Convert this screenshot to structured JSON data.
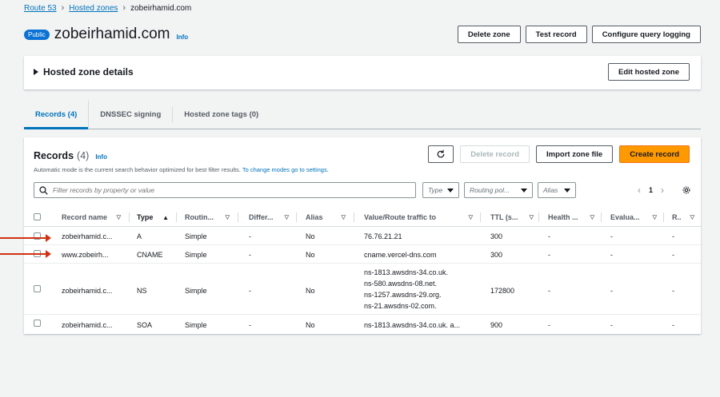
{
  "breadcrumb": {
    "items": [
      "Route 53",
      "Hosted zones"
    ],
    "current": "zobeirhamid.com"
  },
  "header": {
    "badge": "Public",
    "title": "zobeirhamid.com",
    "info": "Info",
    "buttons": {
      "delete_zone": "Delete zone",
      "test_record": "Test record",
      "configure_logging": "Configure query logging"
    }
  },
  "details": {
    "title": "Hosted zone details",
    "edit_button": "Edit hosted zone"
  },
  "tabs": [
    {
      "label": "Records (4)"
    },
    {
      "label": "DNSSEC signing"
    },
    {
      "label": "Hosted zone tags (0)"
    }
  ],
  "records": {
    "title": "Records",
    "count": "(4)",
    "info": "Info",
    "description": "Automatic mode is the current search behavior optimized for best filter results.",
    "description_link": "To change modes go to settings.",
    "buttons": {
      "delete_record": "Delete record",
      "import_zone_file": "Import zone file",
      "create_record": "Create record"
    },
    "search_placeholder": "Filter records by property or value",
    "filters": {
      "type": "Type",
      "routing_policy": "Routing pol...",
      "alias": "Alias"
    },
    "page": "1",
    "columns": {
      "record_name": "Record name",
      "type": "Type",
      "routing": "Routin...",
      "differ": "Differ...",
      "alias": "Alias",
      "value": "Value/Route traffic to",
      "ttl": "TTL (s...",
      "health": "Health ...",
      "evalua": "Evalua...",
      "r": "R.."
    },
    "rows": [
      {
        "name": "zobeirhamid.c...",
        "type": "A",
        "routing": "Simple",
        "differ": "-",
        "alias": "No",
        "value": [
          "76.76.21.21"
        ],
        "ttl": "300",
        "health": "-",
        "evalua": "-",
        "r": "-"
      },
      {
        "name": "www.zobeirh...",
        "type": "CNAME",
        "routing": "Simple",
        "differ": "-",
        "alias": "No",
        "value": [
          "cname.vercel-dns.com"
        ],
        "ttl": "300",
        "health": "-",
        "evalua": "-",
        "r": "-"
      },
      {
        "name": "zobeirhamid.c...",
        "type": "NS",
        "routing": "Simple",
        "differ": "-",
        "alias": "No",
        "value": [
          "ns-1813.awsdns-34.co.uk.",
          "ns-580.awsdns-08.net.",
          "ns-1257.awsdns-29.org.",
          "ns-21.awsdns-02.com."
        ],
        "ttl": "172800",
        "health": "-",
        "evalua": "-",
        "r": "-"
      },
      {
        "name": "zobeirhamid.c...",
        "type": "SOA",
        "routing": "Simple",
        "differ": "-",
        "alias": "No",
        "value": [
          "ns-1813.awsdns-34.co.uk. a..."
        ],
        "ttl": "900",
        "health": "-",
        "evalua": "-",
        "r": "-"
      }
    ]
  },
  "colors": {
    "accent": "#0073bb",
    "primary_button": "#ff9900",
    "annotation_arrow": "#d13212"
  }
}
